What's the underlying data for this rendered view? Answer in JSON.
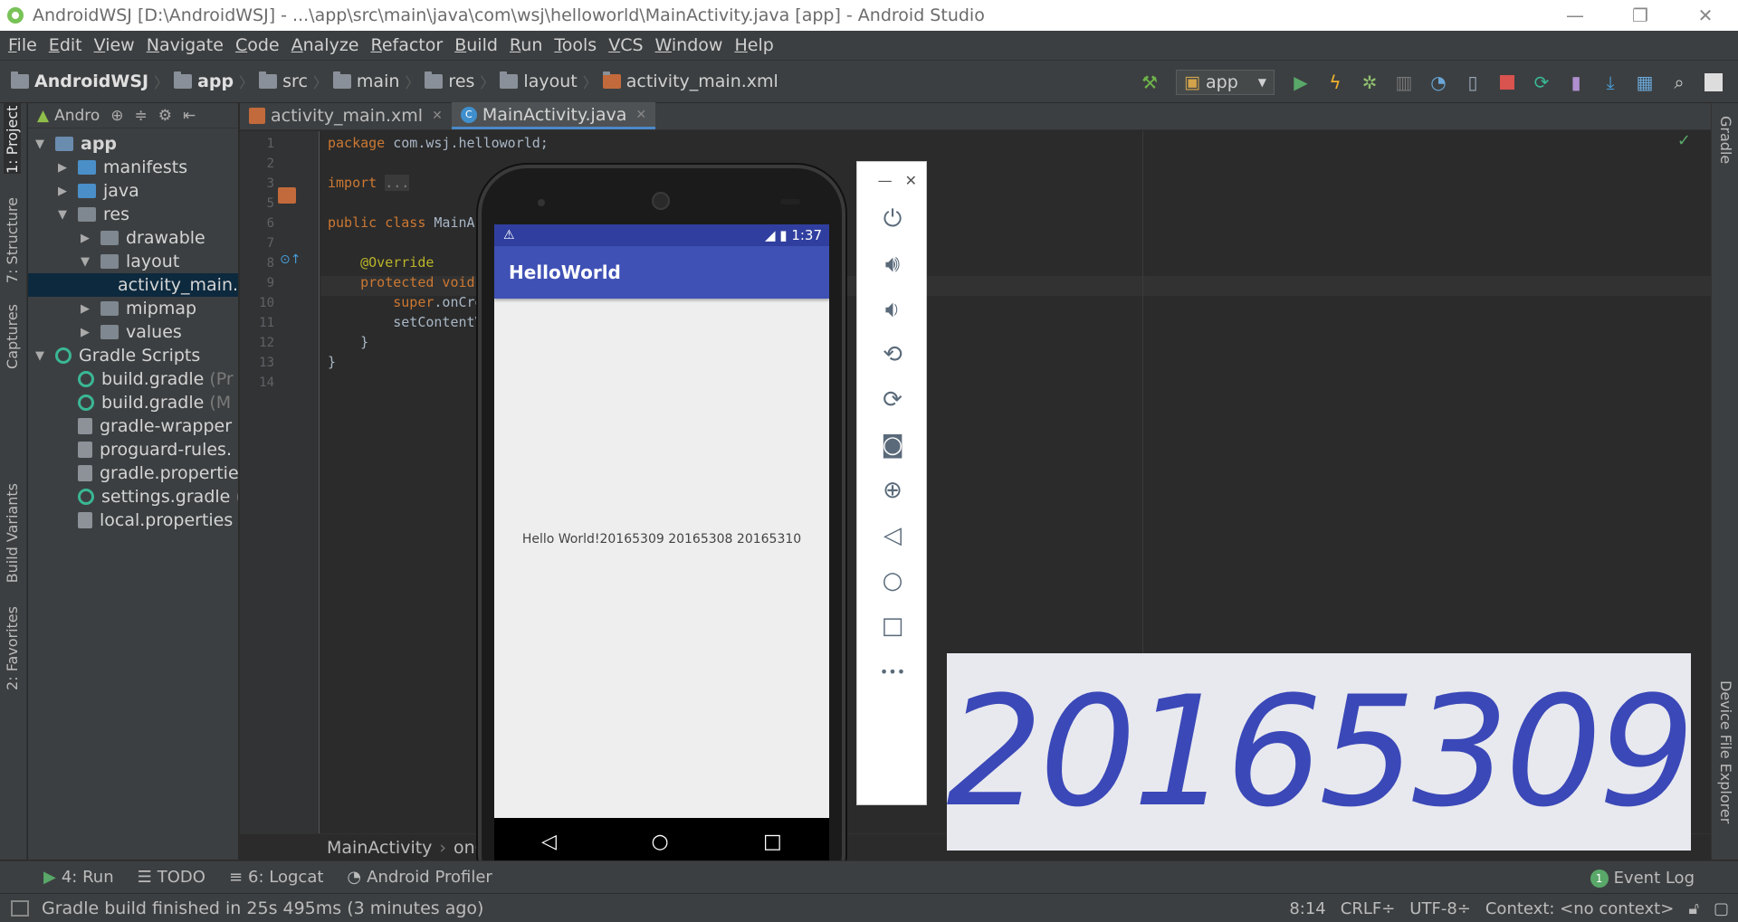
{
  "window": {
    "title": "AndroidWSJ [D:\\AndroidWSJ] - ...\\app\\src\\main\\java\\com\\wsj\\helloworld\\MainActivity.java [app] - Android Studio"
  },
  "menu": [
    "File",
    "Edit",
    "View",
    "Navigate",
    "Code",
    "Analyze",
    "Refactor",
    "Build",
    "Run",
    "Tools",
    "VCS",
    "Window",
    "Help"
  ],
  "breadcrumbs": [
    "AndroidWSJ",
    "app",
    "src",
    "main",
    "res",
    "layout",
    "activity_main.xml"
  ],
  "toolbar": {
    "run_config": "app"
  },
  "left_tabs": [
    "1: Project",
    "7: Structure",
    "Captures",
    "Build Variants",
    "2: Favorites"
  ],
  "right_tabs": [
    "Gradle",
    "Device File Explorer"
  ],
  "project_panel": {
    "view": "Andro",
    "tree": [
      {
        "label": "app",
        "indent": 0,
        "arrow": "open",
        "icon": "app"
      },
      {
        "label": "manifests",
        "indent": 1,
        "arrow": "closed",
        "icon": "blue"
      },
      {
        "label": "java",
        "indent": 1,
        "arrow": "closed",
        "icon": "blue"
      },
      {
        "label": "res",
        "indent": 1,
        "arrow": "open",
        "icon": "grey"
      },
      {
        "label": "drawable",
        "indent": 2,
        "arrow": "closed",
        "icon": "grey"
      },
      {
        "label": "layout",
        "indent": 2,
        "arrow": "open",
        "icon": "grey"
      },
      {
        "label": "activity_main.xml",
        "indent": 3,
        "arrow": "none",
        "icon": "xml",
        "selected": true
      },
      {
        "label": "mipmap",
        "indent": 2,
        "arrow": "closed",
        "icon": "grey"
      },
      {
        "label": "values",
        "indent": 2,
        "arrow": "closed",
        "icon": "grey"
      },
      {
        "label": "Gradle Scripts",
        "indent": 0,
        "arrow": "open",
        "icon": "gradle"
      },
      {
        "label": "build.gradle",
        "suffix": "(Pr",
        "indent": 1,
        "arrow": "none",
        "icon": "gradle"
      },
      {
        "label": "build.gradle",
        "suffix": "(M",
        "indent": 1,
        "arrow": "none",
        "icon": "gradle"
      },
      {
        "label": "gradle-wrapper",
        "indent": 1,
        "arrow": "none",
        "icon": "props"
      },
      {
        "label": "proguard-rules.",
        "indent": 1,
        "arrow": "none",
        "icon": "props"
      },
      {
        "label": "gradle.properties",
        "indent": 1,
        "arrow": "none",
        "icon": "props"
      },
      {
        "label": "settings.gradle",
        "suffix": "(",
        "indent": 1,
        "arrow": "none",
        "icon": "gradle"
      },
      {
        "label": "local.properties",
        "indent": 1,
        "arrow": "none",
        "icon": "props"
      }
    ]
  },
  "editor_tabs": [
    {
      "label": "activity_main.xml",
      "active": false,
      "icon": "xml"
    },
    {
      "label": "MainActivity.java",
      "active": true,
      "icon": "class"
    }
  ],
  "code_lines": [
    {
      "n": "1",
      "html": "<span class=\"kw\">package</span> com.wsj.helloworld;"
    },
    {
      "n": "2",
      "html": ""
    },
    {
      "n": "3",
      "html": "<span class=\"kw\">import</span> <span class=\"fold\">...</span>"
    },
    {
      "n": "5",
      "html": ""
    },
    {
      "n": "6",
      "html": "<span class=\"kw\">public class</span> MainActivity"
    },
    {
      "n": "7",
      "html": ""
    },
    {
      "n": "8",
      "html": "    <span class=\"ann\">@Override</span>"
    },
    {
      "n": "9",
      "html": "    <span class=\"kw\">protected void</span> onCreate"
    },
    {
      "n": "10",
      "html": "        <span class=\"kw\">super</span>.onCreate"
    },
    {
      "n": "11",
      "html": "        setContentView"
    },
    {
      "n": "12",
      "html": "    }"
    },
    {
      "n": "13",
      "html": "}"
    },
    {
      "n": "14",
      "html": ""
    }
  ],
  "editor_breadcrumb": [
    "MainActivity",
    "onC"
  ],
  "emulator": {
    "time": "1:37",
    "app_title": "HelloWorld",
    "text": "Hello World!20165309 20165308 20165310"
  },
  "emulator_controls": [
    "power-icon",
    "volume-up-icon",
    "volume-down-icon",
    "rotate-left-icon",
    "rotate-right-icon",
    "camera-icon",
    "zoom-icon",
    "back-icon",
    "home-icon",
    "overview-icon",
    "more-icon"
  ],
  "banner_text": "20165309",
  "bottom_tools": [
    {
      "label": "4: Run",
      "icon": "▶"
    },
    {
      "label": "TODO",
      "icon": "☰"
    },
    {
      "label": "6: Logcat",
      "icon": "≡"
    },
    {
      "label": "Android Profiler",
      "icon": "◔"
    }
  ],
  "event_log": {
    "count": "1",
    "label": "Event Log"
  },
  "status": {
    "message": "Gradle build finished in 25s 495ms (3 minutes ago)",
    "position": "8:14",
    "line_sep": "CRLF÷",
    "encoding": "UTF-8÷",
    "context": "Context: <no context>"
  }
}
